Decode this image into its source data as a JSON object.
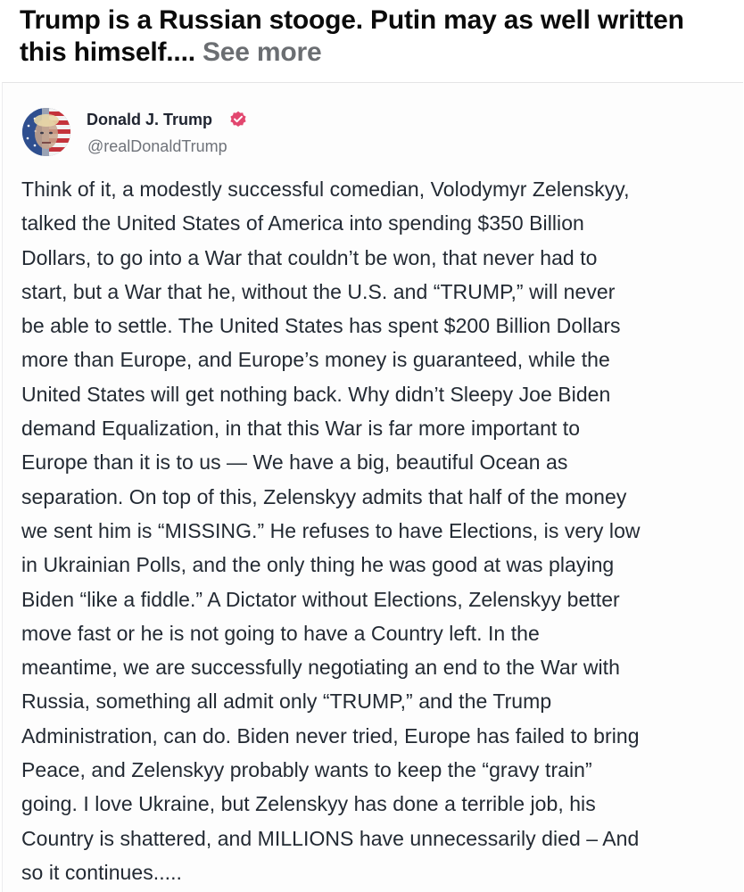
{
  "caption": {
    "text": "Trump is a Russian stooge. Putin may as well written this himself....",
    "see_more": "See more"
  },
  "embedded_post": {
    "author_name": "Donald J. Trump",
    "author_handle": "@realDonaldTrump",
    "verified": true,
    "avatar_icon": "avatar-flag-portrait",
    "body": "Think of it, a modestly successful comedian, Volodymyr Zelenskyy,\ntalked the United States of America into spending $350 Billion\nDollars, to go into a War that couldn’t be won, that never had to\nstart, but a War that he, without the U.S. and “TRUMP,” will never\nbe able to settle. The United States has spent $200 Billion Dollars\nmore than Europe, and Europe’s money is guaranteed, while the\nUnited States will get nothing back. Why didn’t Sleepy Joe Biden\ndemand Equalization, in that this War is far more important to\nEurope than it is to us — We have a big, beautiful Ocean as\nseparation. On top of this, Zelenskyy admits that half of the money\nwe sent him is “MISSING.” He refuses to have Elections, is very low\nin Ukrainian Polls, and the only thing he was good at was playing\nBiden “like a fiddle.” A Dictator without Elections, Zelenskyy better\nmove fast or he is not going to have a Country left. In the\nmeantime, we are successfully negotiating an end to the War with\nRussia, something all admit only “TRUMP,” and the Trump\nAdministration, can do. Biden never tried, Europe has failed to bring\nPeace, and Zelenskyy probably wants to keep the “gravy train”\ngoing. I love Ukraine, but Zelenskyy has done a terrible job, his\nCountry is shattered, and MILLIONS have unnecessarily died – And\nso it continues....."
  },
  "colors": {
    "verified_badge": "#e2476f",
    "see_more": "#6b6e72",
    "body_text": "#232a33",
    "handle": "#6f737a"
  }
}
